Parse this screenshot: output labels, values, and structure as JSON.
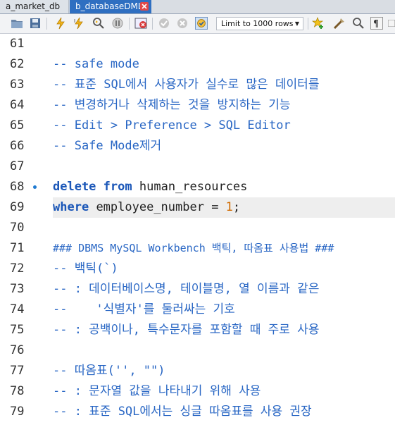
{
  "tabs": [
    {
      "label": "a_market_db"
    },
    {
      "label": "b_databaseDML"
    }
  ],
  "toolbar": {
    "limit_select": "Limit to 1000 rows",
    "icons": [
      "open-folder-icon",
      "save-icon",
      "execute-icon",
      "execute-current-icon",
      "explain-icon",
      "stop-icon",
      "toggle-error-icon",
      "commit-icon",
      "rollback-icon",
      "autocommit-icon",
      "add-snippet-icon",
      "beautify-icon",
      "find-icon",
      "invisible-chars-icon",
      "wrap-icon"
    ]
  },
  "editor": {
    "lines": [
      {
        "num": "61",
        "text": ""
      },
      {
        "num": "62",
        "text": "-- safe mode"
      },
      {
        "num": "63",
        "text": "-- 표준 SQL에서 사용자가 실수로 많은 데이터를"
      },
      {
        "num": "64",
        "text": "-- 변경하거나 삭제하는 것을 방지하는 기능"
      },
      {
        "num": "65",
        "text": "-- Edit > Preference > SQL Editor"
      },
      {
        "num": "66",
        "text": "-- Safe Mode제거"
      },
      {
        "num": "67",
        "text": ""
      },
      {
        "num": "68",
        "text": "delete from human_resources"
      },
      {
        "num": "69",
        "text": "where employee_number = 1;"
      },
      {
        "num": "70",
        "text": ""
      },
      {
        "num": "71",
        "text": "### DBMS MySQL Workbench 백틱, 따옴표 사용법 ###"
      },
      {
        "num": "72",
        "text": "-- 백틱(`)"
      },
      {
        "num": "73",
        "text": "-- : 데이터베이스명, 테이블명, 열 이름과 같은"
      },
      {
        "num": "74",
        "text": "--    '식별자'를 둘러싸는 기호"
      },
      {
        "num": "75",
        "text": "-- : 공백이나, 특수문자를 포함할 때 주로 사용"
      },
      {
        "num": "76",
        "text": ""
      },
      {
        "num": "77",
        "text": "-- 따옴표('', \"\")"
      },
      {
        "num": "78",
        "text": "-- : 문자열 값을 나타내기 위해 사용"
      },
      {
        "num": "79",
        "text": "-- : 표준 SQL에서는 싱글 따옴표를 사용 권장"
      }
    ],
    "sql": {
      "delete_kw": "delete",
      "from_kw": "from",
      "table": "human_resources",
      "where_kw": "where",
      "cond_lhs": "employee_number = ",
      "cond_val": "1",
      "terminator": ";"
    }
  }
}
